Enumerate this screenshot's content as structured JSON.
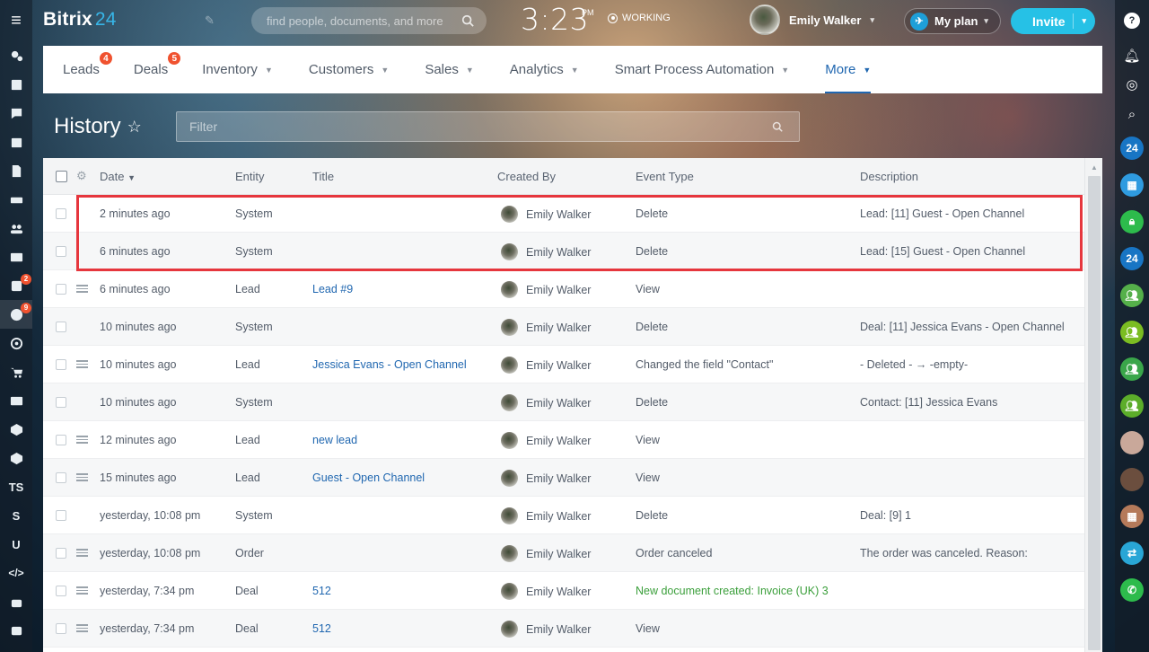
{
  "header": {
    "logo_text": "Bitrix",
    "logo_num": "24",
    "search_placeholder": "find people, documents, and more",
    "time": "3:23",
    "ampm": "PM",
    "work_status": "WORKING",
    "user_name": "Emily Walker",
    "my_plan": "My plan",
    "invite": "Invite"
  },
  "left_sidebar": {
    "items": [
      {
        "name": "feed",
        "label": ""
      },
      {
        "name": "tasks-list",
        "label": ""
      },
      {
        "name": "chat",
        "label": ""
      },
      {
        "name": "calendar",
        "label": ""
      },
      {
        "name": "documents",
        "label": ""
      },
      {
        "name": "drive",
        "label": ""
      },
      {
        "name": "employees",
        "label": ""
      },
      {
        "name": "mail",
        "label": ""
      },
      {
        "name": "tasks",
        "label": "",
        "badge": "2"
      },
      {
        "name": "crm",
        "label": "",
        "badge": "9",
        "active": true
      },
      {
        "name": "sales",
        "label": ""
      },
      {
        "name": "store",
        "label": ""
      },
      {
        "name": "contact-center",
        "label": ""
      },
      {
        "name": "smart-process-1",
        "label": ""
      },
      {
        "name": "smart-process-2",
        "label": ""
      },
      {
        "name": "ts",
        "label": "TS"
      },
      {
        "name": "s",
        "label": "S"
      },
      {
        "name": "u",
        "label": "U"
      },
      {
        "name": "developer",
        "label": ""
      },
      {
        "name": "robot",
        "label": ""
      },
      {
        "name": "apps",
        "label": ""
      }
    ]
  },
  "nav": {
    "items": [
      {
        "label": "Leads",
        "badge": "4"
      },
      {
        "label": "Deals",
        "badge": "5"
      },
      {
        "label": "Inventory",
        "dropdown": true
      },
      {
        "label": "Customers",
        "dropdown": true
      },
      {
        "label": "Sales",
        "dropdown": true
      },
      {
        "label": "Analytics",
        "dropdown": true
      },
      {
        "label": "Smart Process Automation",
        "dropdown": true
      },
      {
        "label": "More",
        "dropdown": true,
        "active": true
      }
    ]
  },
  "page": {
    "title": "History",
    "filter_placeholder": "Filter"
  },
  "table": {
    "columns": {
      "date": "Date",
      "entity": "Entity",
      "title": "Title",
      "created_by": "Created By",
      "event_type": "Event Type",
      "description": "Description"
    },
    "rows": [
      {
        "date": "2 minutes ago",
        "entity": "System",
        "title": "",
        "created_by": "Emily Walker",
        "event_type": "Delete",
        "description": "Lead: [11] Guest - Open Channel",
        "menu": false
      },
      {
        "date": "6 minutes ago",
        "entity": "System",
        "title": "",
        "created_by": "Emily Walker",
        "event_type": "Delete",
        "description": "Lead: [15] Guest - Open Channel",
        "menu": false
      },
      {
        "date": "6 minutes ago",
        "entity": "Lead",
        "title": "Lead #9",
        "created_by": "Emily Walker",
        "event_type": "View",
        "description": "",
        "menu": true
      },
      {
        "date": "10 minutes ago",
        "entity": "System",
        "title": "",
        "created_by": "Emily Walker",
        "event_type": "Delete",
        "description": "Deal: [11] Jessica Evans - Open Channel",
        "menu": false
      },
      {
        "date": "10 minutes ago",
        "entity": "Lead",
        "title": "Jessica Evans - Open Channel",
        "created_by": "Emily Walker",
        "event_type": "Changed the field \"Contact\"",
        "description": "- Deleted - → -empty-",
        "menu": true
      },
      {
        "date": "10 minutes ago",
        "entity": "System",
        "title": "",
        "created_by": "Emily Walker",
        "event_type": "Delete",
        "description": "Contact: [11] Jessica Evans",
        "menu": false
      },
      {
        "date": "12 minutes ago",
        "entity": "Lead",
        "title": "new lead",
        "created_by": "Emily Walker",
        "event_type": "View",
        "description": "",
        "menu": true
      },
      {
        "date": "15 minutes ago",
        "entity": "Lead",
        "title": "Guest - Open Channel",
        "created_by": "Emily Walker",
        "event_type": "View",
        "description": "",
        "menu": true
      },
      {
        "date": "yesterday, 10:08 pm",
        "entity": "System",
        "title": "",
        "created_by": "Emily Walker",
        "event_type": "Delete",
        "description": "Deal: [9] 1",
        "menu": false
      },
      {
        "date": "yesterday, 10:08 pm",
        "entity": "Order",
        "title": "",
        "created_by": "Emily Walker",
        "event_type": "Order canceled",
        "description": "The order was canceled. Reason:",
        "menu": true
      },
      {
        "date": "yesterday, 7:34 pm",
        "entity": "Deal",
        "title": "512",
        "created_by": "Emily Walker",
        "event_type": "New document created: Invoice (UK) 3",
        "description": "",
        "menu": true,
        "event_green": true
      },
      {
        "date": "yesterday, 7:34 pm",
        "entity": "Deal",
        "title": "512",
        "created_by": "Emily Walker",
        "event_type": "View",
        "description": "",
        "menu": true
      }
    ]
  },
  "right_sidebar": {
    "items": [
      {
        "name": "help",
        "label": "?"
      },
      {
        "name": "notifications",
        "label": ""
      },
      {
        "name": "chat-list",
        "label": ""
      },
      {
        "name": "search",
        "label": ""
      },
      {
        "name": "bitrix24-chat",
        "label": "24"
      },
      {
        "name": "calendar-chat",
        "label": ""
      },
      {
        "name": "lock-chat",
        "label": ""
      },
      {
        "name": "bitrix24-support",
        "label": "24"
      },
      {
        "name": "group-chat-1",
        "label": ""
      },
      {
        "name": "group-chat-2",
        "label": ""
      },
      {
        "name": "group-chat-3",
        "label": ""
      },
      {
        "name": "group-chat-4",
        "label": ""
      },
      {
        "name": "user-chat-1",
        "label": ""
      },
      {
        "name": "user-chat-2",
        "label": ""
      },
      {
        "name": "calendar-chat-2",
        "label": ""
      },
      {
        "name": "transfer",
        "label": ""
      },
      {
        "name": "phone",
        "label": ""
      }
    ]
  }
}
